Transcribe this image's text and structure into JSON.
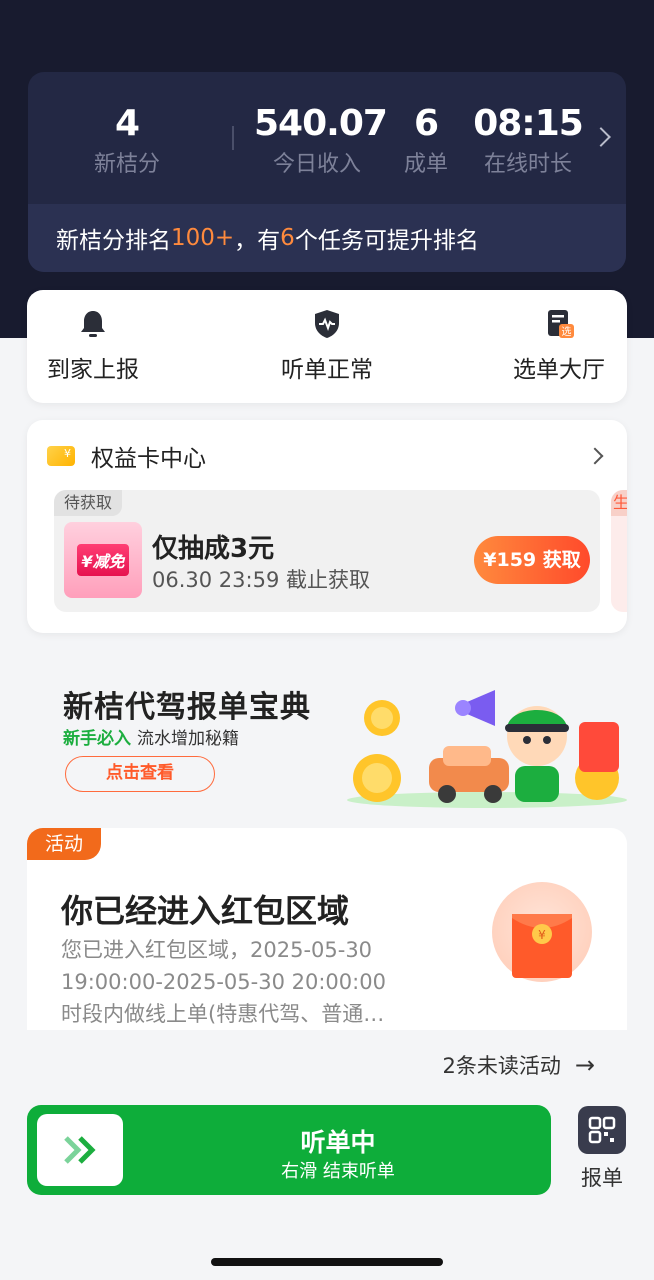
{
  "stats": {
    "items": [
      {
        "value": "4",
        "label": "新桔分"
      },
      {
        "value": "540.07",
        "label": "今日收入"
      },
      {
        "value": "6",
        "label": "成单"
      },
      {
        "value": "08:15",
        "label": "在线时长"
      }
    ],
    "rank": {
      "prefix": "新桔分排名",
      "rank": "100+",
      "middle": "，有",
      "count": "6",
      "suffix": "个任务可提升排名"
    }
  },
  "quick_actions": [
    {
      "label": "到家上报",
      "icon": "bell-icon"
    },
    {
      "label": "听单正常",
      "icon": "shield-pulse-icon"
    },
    {
      "label": "选单大厅",
      "icon": "select-doc-icon"
    }
  ],
  "benefit": {
    "title": "权益卡中心",
    "coupon": {
      "tag": "待获取",
      "image_text": "¥减免",
      "title": "仅抽成3元",
      "subtitle": "06.30 23:59 截止获取",
      "button": "¥159 获取"
    },
    "peek_tag": "生"
  },
  "banner": {
    "title": "新桔代驾报单宝典",
    "sub_highlight": "新手必入",
    "sub_text": "流水增加秘籍",
    "button": "点击查看"
  },
  "activity": {
    "tag": "活动",
    "title": "你已经进入红包区域",
    "description": "您已进入红包区域，2025-05-30\n19:00:00-2025-05-30 20:00:00\n时段内做线上单(特惠代驾、普通…",
    "more": "2条未读活动"
  },
  "bottom": {
    "status": "听单中",
    "hint": "右滑  结束听单",
    "report_label": "报单"
  },
  "colors": {
    "accent_orange": "#ff8a3d",
    "brand_green": "#0ead3a",
    "header_dark": "#181b2f"
  }
}
